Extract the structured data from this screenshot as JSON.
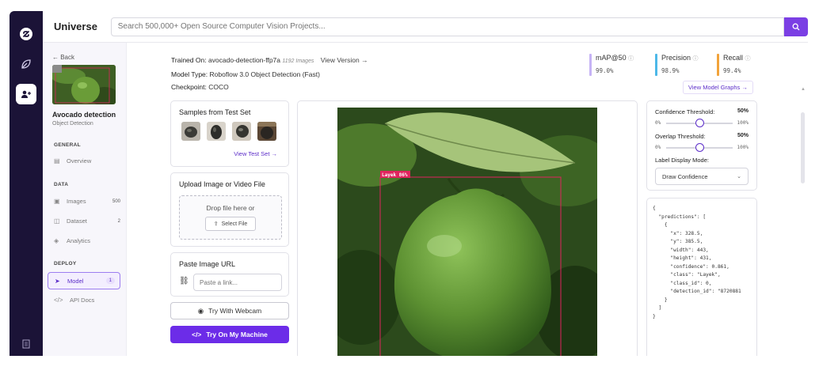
{
  "topbar": {
    "brand": "Universe",
    "search_placeholder": "Search 500,000+ Open Source Computer Vision Projects..."
  },
  "project": {
    "back_label": "← Back",
    "title": "Avocado detection",
    "subtitle": "Object Detection",
    "sections": {
      "general": "GENERAL",
      "data": "DATA",
      "deploy": "DEPLOY"
    },
    "nav": {
      "overview": "Overview",
      "images": "Images",
      "images_count": "500",
      "dataset": "Dataset",
      "dataset_count": "2",
      "analytics": "Analytics",
      "model": "Model",
      "model_count": "1",
      "api_docs": "API Docs"
    }
  },
  "model_info": {
    "trained_on_label": "Trained On:",
    "trained_on_value": "avocado-detection-ffp7a",
    "images_count": "1192 Images",
    "view_version": "View Version →",
    "model_type_label": "Model Type:",
    "model_type_value": "Roboflow 3.0 Object Detection (Fast)",
    "checkpoint_label": "Checkpoint:",
    "checkpoint_value": "COCO"
  },
  "metrics": [
    {
      "label": "mAP@50",
      "value": "99.0%",
      "color": "#c6b3f5"
    },
    {
      "label": "Precision",
      "value": "98.9%",
      "color": "#4db8e8"
    },
    {
      "label": "Recall",
      "value": "99.4%",
      "color": "#f2a33a"
    }
  ],
  "view_model_graphs": "View Model Graphs →",
  "samples": {
    "title": "Samples from Test Set",
    "view_link": "View Test Set →"
  },
  "upload": {
    "title": "Upload Image or Video File",
    "drop_text": "Drop file here or",
    "select_label": "Select File"
  },
  "paste": {
    "title": "Paste Image URL",
    "placeholder": "Paste a link..."
  },
  "buttons": {
    "webcam": "Try With Webcam",
    "machine": "Try On My Machine"
  },
  "detection": {
    "label": "Layek 86%"
  },
  "controls": {
    "confidence_label": "Confidence Threshold:",
    "confidence_value": "50%",
    "confidence_level": 0.5,
    "overlap_label": "Overlap Threshold:",
    "overlap_value": "50%",
    "overlap_level": 0.5,
    "min": "0%",
    "max": "100%",
    "label_mode_title": "Label Display Mode:",
    "label_mode_value": "Draw Confidence"
  },
  "json_output": "{\n  \"predictions\": [\n    {\n      \"x\": 328.5,\n      \"y\": 385.5,\n      \"width\": 443,\n      \"height\": 431,\n      \"confidence\": 0.861,\n      \"class\": \"Layek\",\n      \"class_id\": 0,\n      \"detection_id\": \"8720881\n    }\n  ]\n}"
}
